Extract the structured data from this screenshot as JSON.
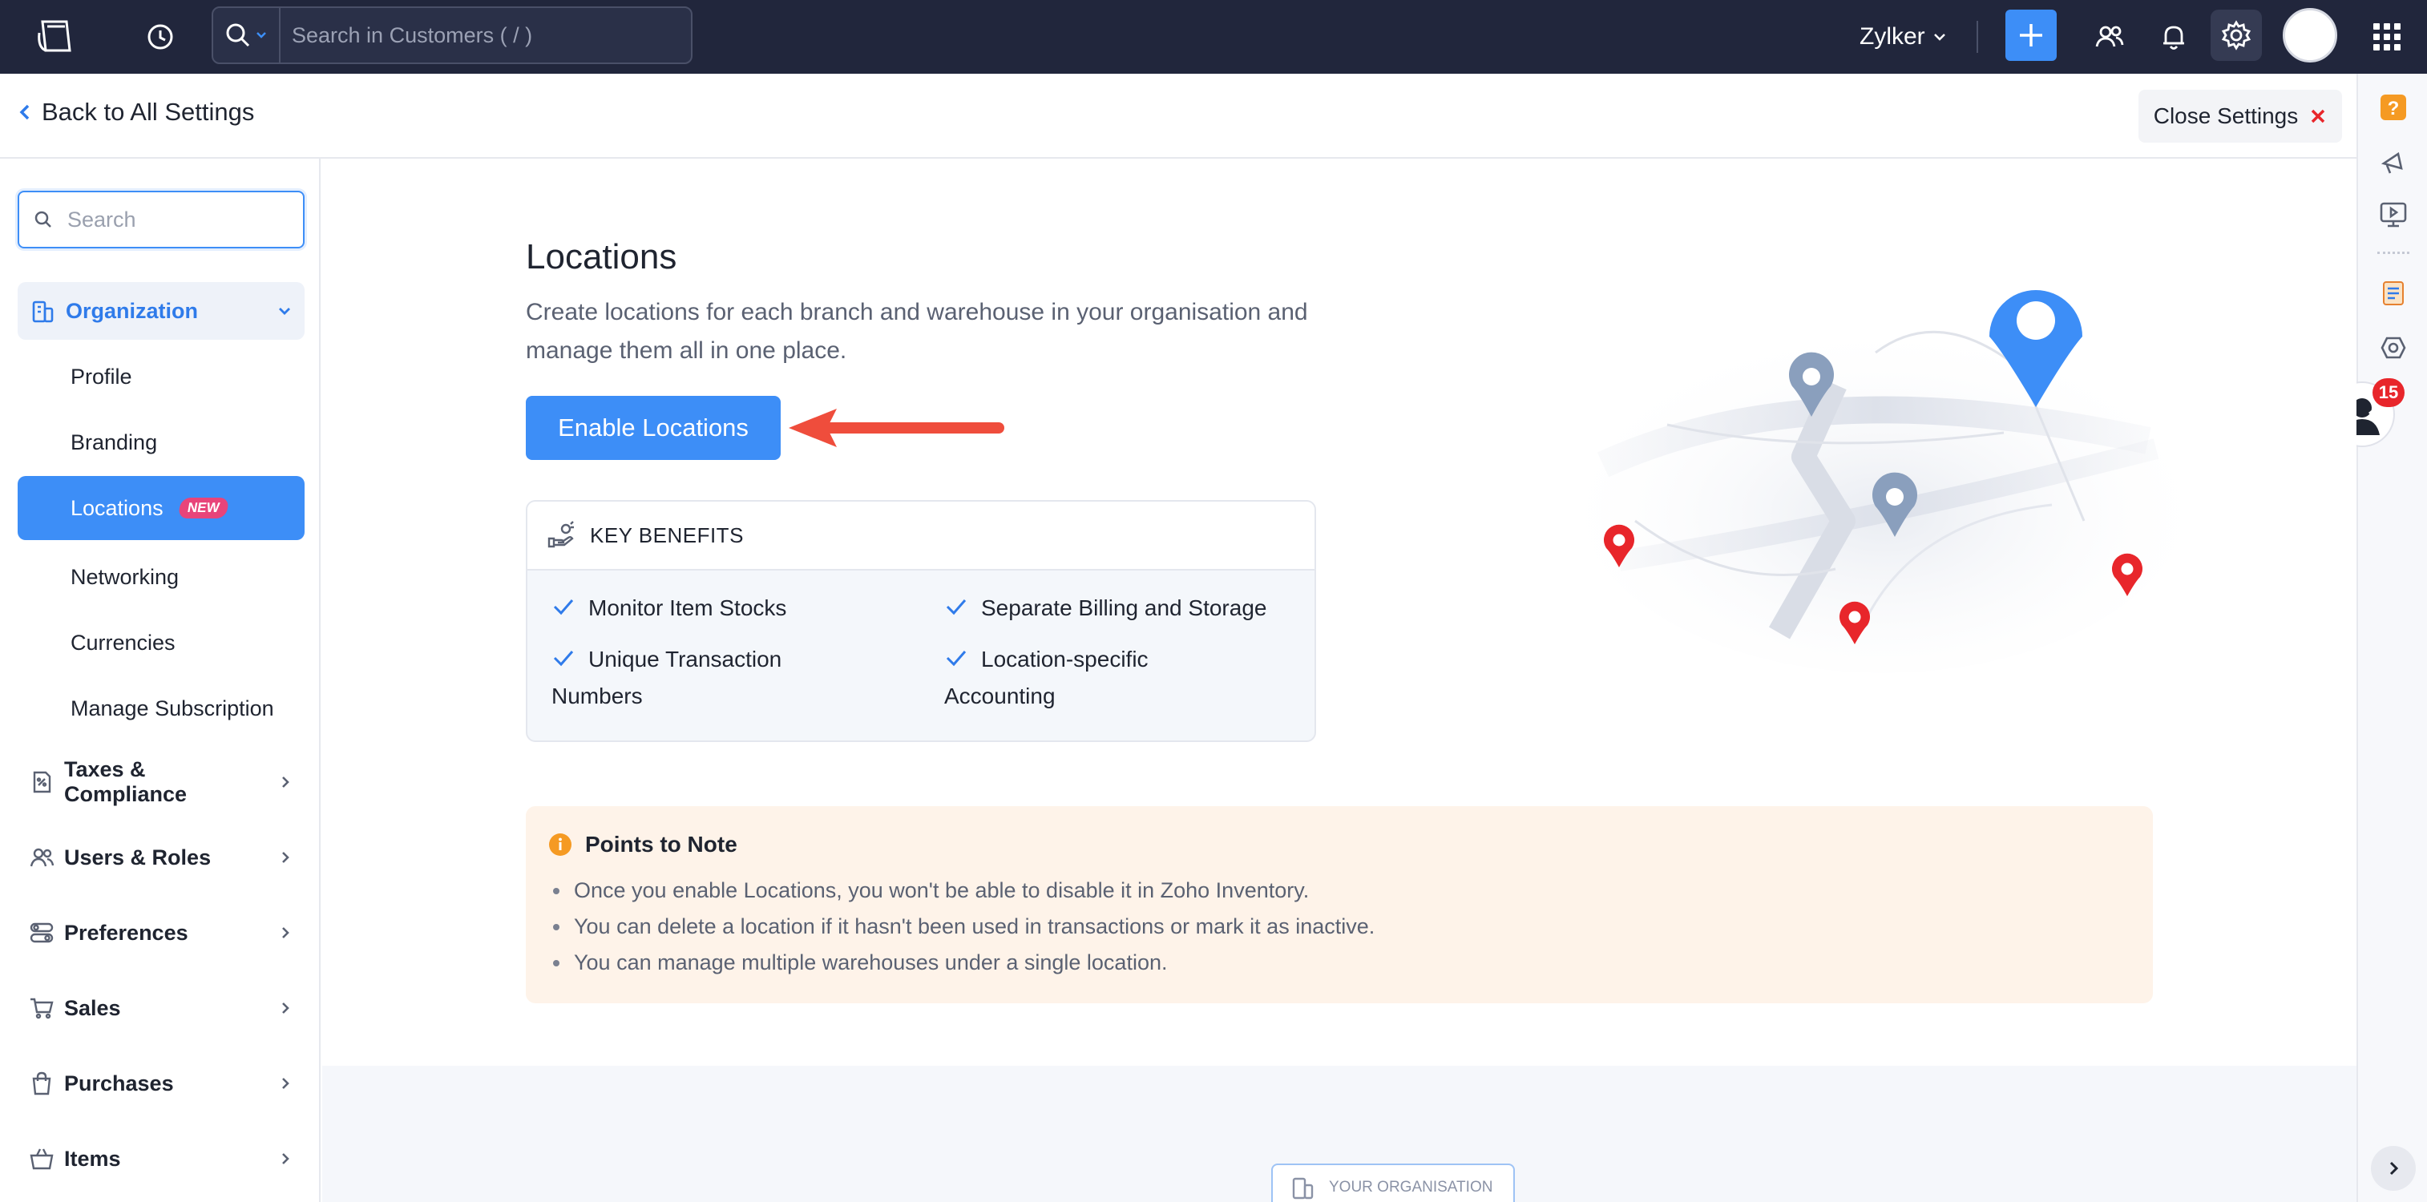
{
  "topbar": {
    "search_placeholder": "Search in Customers ( / )",
    "org_name": "Zylker",
    "icons": [
      "logo-icon",
      "history-icon",
      "search-icon",
      "plus-icon",
      "users-icon",
      "bell-icon",
      "gear-icon",
      "avatar",
      "apps-grid-icon"
    ]
  },
  "header": {
    "back_label": "Back to All Settings",
    "close_label": "Close Settings"
  },
  "sidebar": {
    "search_placeholder": "Search",
    "organization": {
      "label": "Organization",
      "items": [
        "Profile",
        "Branding",
        "Locations",
        "Networking",
        "Currencies",
        "Manage Subscription"
      ],
      "selected": "Locations",
      "new_badge": "NEW"
    },
    "groups": [
      "Taxes & Compliance",
      "Users & Roles",
      "Preferences",
      "Sales",
      "Purchases",
      "Items"
    ]
  },
  "main": {
    "title": "Locations",
    "description": "Create locations for each branch and warehouse in your organisation and manage them all in one place.",
    "enable_button": "Enable Locations",
    "benefits": {
      "title": "KEY BENEFITS",
      "items": [
        "Monitor Item Stocks",
        "Separate Billing and Storage",
        "Unique Transaction Numbers",
        "Location-specific Accounting"
      ]
    },
    "notes": {
      "title": "Points to Note",
      "items": [
        "Once you enable Locations, you won't be able to disable it in Zoho Inventory.",
        "You can delete a location if it hasn't been used in transactions or mark it as inactive.",
        "You can manage multiple warehouses under a single location."
      ]
    },
    "org_chip": "YOUR ORGANISATION"
  },
  "right_rail": {
    "badge_count": "15",
    "icons": [
      "help-icon",
      "announcement-icon",
      "video-icon",
      "notes-icon",
      "support-icon"
    ]
  },
  "colors": {
    "topbar_bg": "#21263c",
    "accent": "#3d8ef7",
    "arrow": "#ef4d3c",
    "notes_bg": "#fef3e9"
  }
}
